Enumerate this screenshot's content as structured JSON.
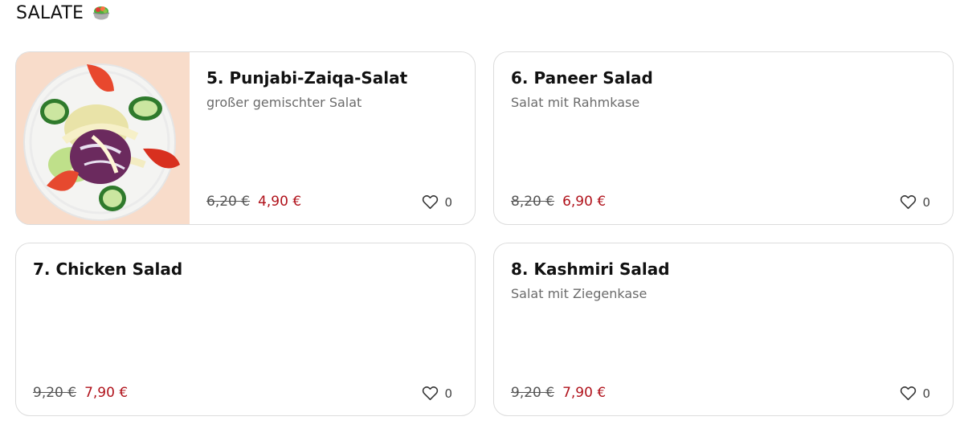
{
  "section": {
    "title": "SALATE",
    "emoji_icon": "salad-bowl-icon"
  },
  "items": [
    {
      "title": "5. Punjabi-Zaiqa-Salat",
      "description": "großer gemischter Salat",
      "old_price": "6,20 €",
      "price": "4,90 €",
      "likes": "0",
      "has_image": true
    },
    {
      "title": "6. Paneer Salad",
      "description": "Salat mit Rahmkase",
      "old_price": "8,20 €",
      "price": "6,90 €",
      "likes": "0",
      "has_image": false
    },
    {
      "title": "7. Chicken Salad",
      "description": "",
      "old_price": "9,20 €",
      "price": "7,90 €",
      "likes": "0",
      "has_image": false
    },
    {
      "title": "8. Kashmiri Salad",
      "description": "Salat mit Ziegenkase",
      "old_price": "9,20 €",
      "price": "7,90 €",
      "likes": "0",
      "has_image": false
    }
  ],
  "colors": {
    "price_accent": "#b0121b",
    "image_background": "#f8dcca",
    "card_border": "#dcdcdc"
  }
}
